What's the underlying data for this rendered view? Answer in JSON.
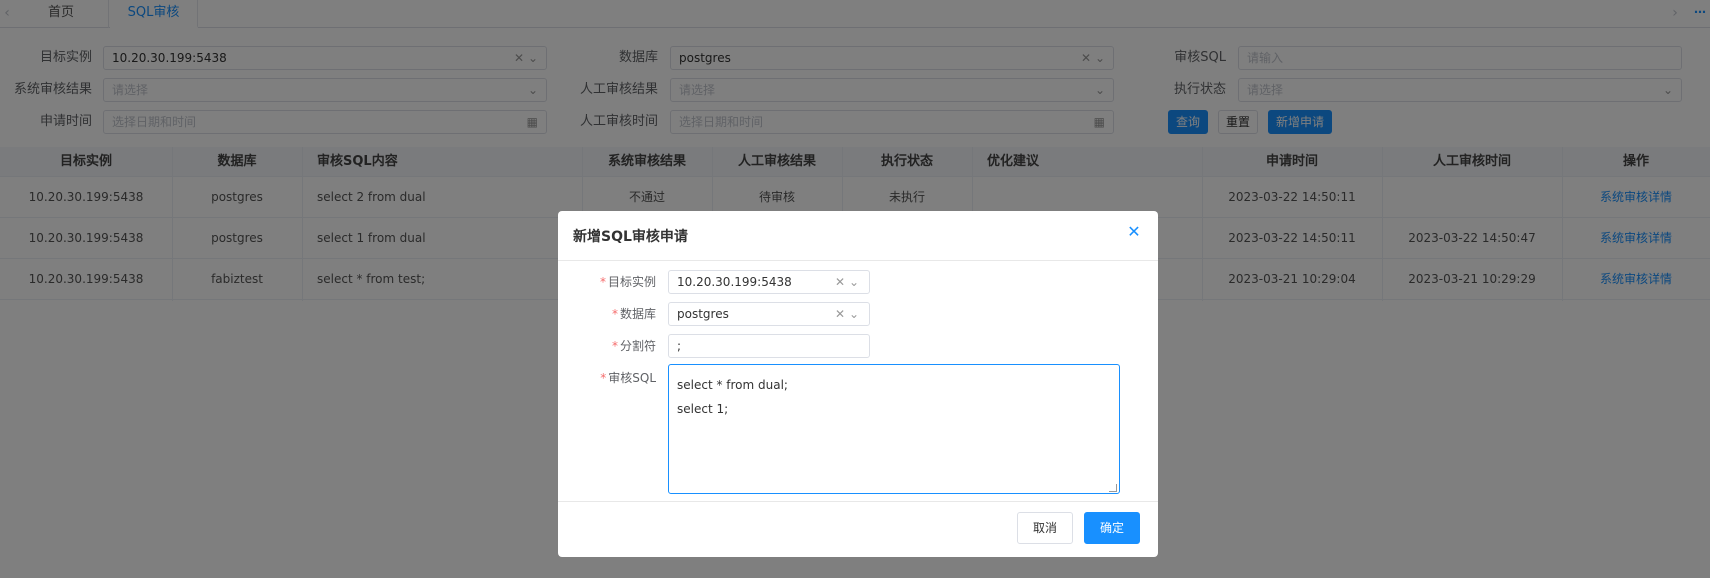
{
  "tabs": [
    {
      "label": "首页",
      "active": false
    },
    {
      "label": "SQL审核",
      "active": true
    }
  ],
  "search": {
    "target_instance_label": "目标实例",
    "target_instance_value": "10.20.30.199:5438",
    "database_label": "数据库",
    "database_value": "postgres",
    "audit_sql_label": "审核SQL",
    "audit_sql_placeholder": "请输入",
    "system_result_label": "系统审核结果",
    "system_result_placeholder": "请选择",
    "manual_result_label": "人工审核结果",
    "manual_result_placeholder": "请选择",
    "exec_status_label": "执行状态",
    "exec_status_placeholder": "请选择",
    "apply_time_label": "申请时间",
    "apply_time_placeholder": "选择日期和时间",
    "manual_time_label": "人工审核时间",
    "manual_time_placeholder": "选择日期和时间",
    "query_button": "查询",
    "reset_button": "重置",
    "new_button": "新增申请"
  },
  "table": {
    "columns": [
      "目标实例",
      "数据库",
      "审核SQL内容",
      "系统审核结果",
      "人工审核结果",
      "执行状态",
      "优化建议",
      "申请时间",
      "人工审核时间",
      "操作"
    ],
    "rows": [
      [
        "10.20.30.199:5438",
        "postgres",
        "select 2 from dual",
        "不通过",
        "待审核",
        "未执行",
        "",
        "2023-03-22 14:50:11",
        "",
        "系统审核详情"
      ],
      [
        "10.20.30.199:5438",
        "postgres",
        "select 1 from dual",
        "",
        "",
        "",
        "",
        "2023-03-22 14:50:11",
        "2023-03-22 14:50:47",
        "系统审核详情"
      ],
      [
        "10.20.30.199:5438",
        "fabiztest",
        "select * from test;",
        "",
        "",
        "",
        "",
        "2023-03-21 10:29:04",
        "2023-03-21 10:29:29",
        "系统审核详情"
      ]
    ]
  },
  "dialog": {
    "title": "新增SQL审核申请",
    "target_label": "目标实例",
    "target_value": "10.20.30.199:5438",
    "db_label": "数据库",
    "db_value": "postgres",
    "sep_label": "分割符",
    "sep_value": ";",
    "sql_label": "审核SQL",
    "sql_lines": [
      "select * from dual;",
      "select 1;"
    ],
    "cancel_button": "取消",
    "ok_button": "确定"
  },
  "icons": {
    "clear": "clear-icon",
    "dropdown": "chevron-down-icon",
    "calendar": "calendar-icon",
    "close": "close-icon",
    "more": "more-icon"
  },
  "colors": {
    "primary": "#1890ff",
    "required": "#f56c6c",
    "overlay": "rgba(0,0,0,0.5)"
  }
}
